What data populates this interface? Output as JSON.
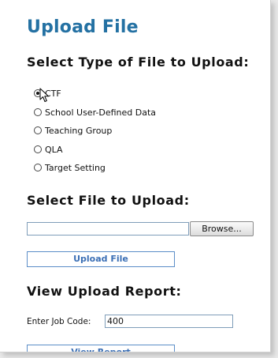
{
  "page": {
    "title": "Upload File"
  },
  "file_type_section": {
    "heading": "Select Type of File to Upload:",
    "selected": "CTF",
    "options": [
      {
        "label": "CTF",
        "checked": true
      },
      {
        "label": "School User-Defined Data",
        "checked": false
      },
      {
        "label": "Teaching Group",
        "checked": false
      },
      {
        "label": "QLA",
        "checked": false
      },
      {
        "label": "Target Setting",
        "checked": false
      }
    ]
  },
  "file_section": {
    "heading": "Select File to Upload:",
    "file_path": "",
    "browse_label": "Browse...",
    "upload_label": "Upload File"
  },
  "report_section": {
    "heading": "View Upload Report:",
    "job_code_label": "Enter Job Code:",
    "job_code_value": "400",
    "view_report_label": "View Report"
  },
  "icons": {
    "cursor": "mouse-pointer-icon",
    "radio": "radio-button-icon"
  },
  "colors": {
    "title": "#2471a3",
    "button_text": "#3b6fb5",
    "button_border": "#5c8ec8",
    "input_border": "#7f9db9"
  }
}
